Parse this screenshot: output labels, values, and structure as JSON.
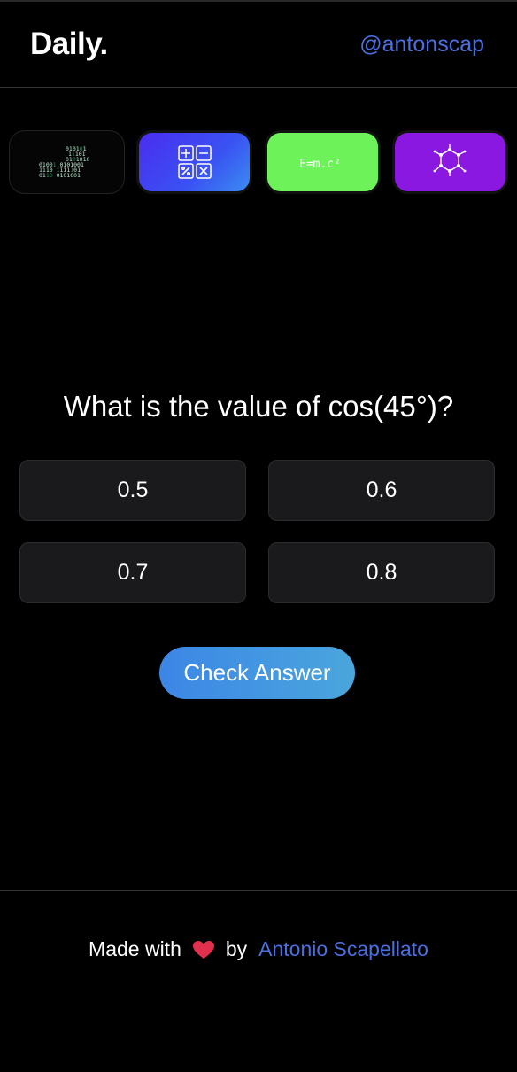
{
  "header": {
    "logo": "Daily.",
    "handle": "@antonscap"
  },
  "categories": [
    {
      "name": "binary",
      "icon": "binary-code-icon"
    },
    {
      "name": "math",
      "icon": "math-operators-icon"
    },
    {
      "name": "physics",
      "icon": "emc2-formula-icon",
      "text": "E=m.c²"
    },
    {
      "name": "chemistry",
      "icon": "molecule-icon"
    }
  ],
  "quiz": {
    "question": "What is the value of cos(45°)?",
    "options": [
      "0.5",
      "0.6",
      "0.7",
      "0.8"
    ],
    "check_label": "Check Answer"
  },
  "footer": {
    "made_with": "Made with",
    "by": "by",
    "author": "Antonio Scapellato",
    "heart_color": "#e0304e"
  },
  "colors": {
    "link": "#4a6fe0",
    "background": "#000000",
    "option_bg": "#1a1a1c"
  }
}
